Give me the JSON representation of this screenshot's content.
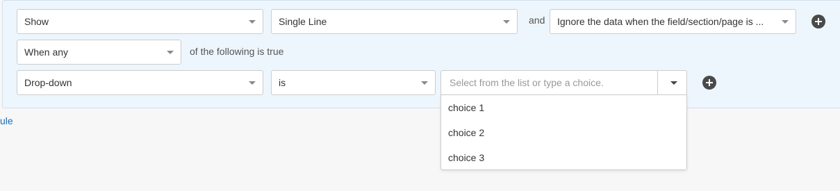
{
  "condition_row1": {
    "action_value": "Show",
    "field_value": "Single Line",
    "connector_text": "and",
    "data_option_value": "Ignore the data when the field/section/page is ..."
  },
  "match_row": {
    "match_value": "When any",
    "match_suffix_text": "of the following is true"
  },
  "criteria_row": {
    "field_value": "Drop-down",
    "operator_value": "is",
    "choice_placeholder": "Select from the list or type a choice."
  },
  "choice_options": [
    "choice 1",
    "choice 2",
    "choice 3"
  ],
  "footer": {
    "rule_link_text": "ule"
  },
  "colors": {
    "panel_bg": "#eef6fd",
    "link": "#1a6fb5",
    "plus_button": "#4a4a4a"
  }
}
